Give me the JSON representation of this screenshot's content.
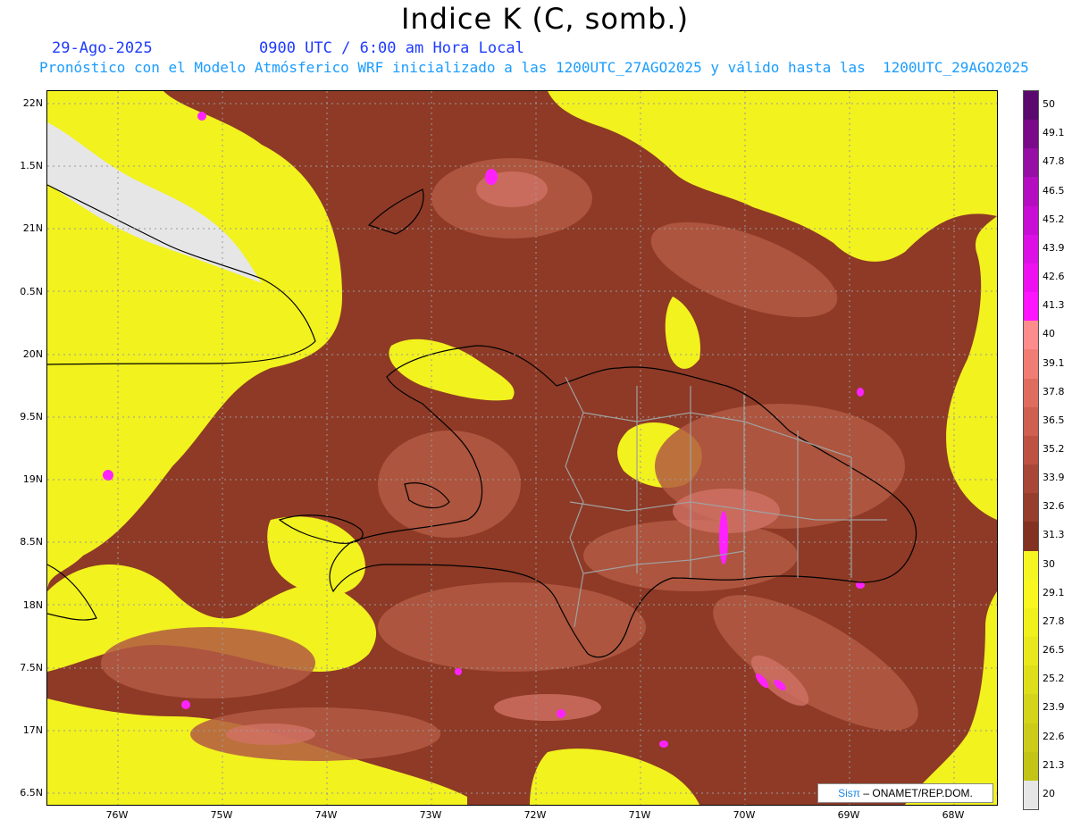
{
  "title": "Indice K (C, somb.)",
  "date": "29-Ago-2025",
  "time_label": "0900 UTC / 6:00 am Hora Local",
  "forecast_line": "Pronóstico con el Modelo Atmósferico WRF inicializado a las 1200UTC_27AGO2025 y válido hasta las  1200UTC_29AGO2025",
  "credit": {
    "logo": "Sisπ",
    "text": "– ONAMET/REP.DOM."
  },
  "axes": {
    "lat_labels": [
      "22N",
      "1.5N",
      "21N",
      "0.5N",
      "20N",
      "9.5N",
      "19N",
      "8.5N",
      "18N",
      "7.5N",
      "17N",
      "6.5N"
    ],
    "lon_labels": [
      "76W",
      "75W",
      "74W",
      "73W",
      "72W",
      "71W",
      "70W",
      "69W",
      "68W"
    ]
  },
  "colorbar": {
    "levels": [
      "50",
      "49.1",
      "47.8",
      "46.5",
      "45.2",
      "43.9",
      "42.6",
      "41.3",
      "40",
      "39.1",
      "37.8",
      "36.5",
      "35.2",
      "33.9",
      "32.6",
      "31.3",
      "30",
      "29.1",
      "27.8",
      "26.5",
      "25.2",
      "23.9",
      "22.6",
      "21.3",
      "20"
    ],
    "colors": [
      "#5a0a6e",
      "#7a0a8a",
      "#950ea5",
      "#b40ec0",
      "#c80ed4",
      "#dc10e4",
      "#ee10f0",
      "#ff14ff",
      "#ff8c8c",
      "#f07c74",
      "#e06c60",
      "#cf5f50",
      "#bd5242",
      "#a94737",
      "#963d2c",
      "#833221",
      "#f5f524",
      "#f8f820",
      "#f0f01c",
      "#e8e81c",
      "#dede1a",
      "#d4d41a",
      "#cccc18",
      "#c4c416",
      "#e6e6e6"
    ]
  },
  "map_colors": {
    "yellow": "#f2f21e",
    "brown": "#8e3a26",
    "brown_light": "#b35a44",
    "pink": "#d17266",
    "magenta": "#ff22ff",
    "land_grey": "#e6e6e6",
    "coast": "#000000",
    "province": "#a0a0a0"
  }
}
